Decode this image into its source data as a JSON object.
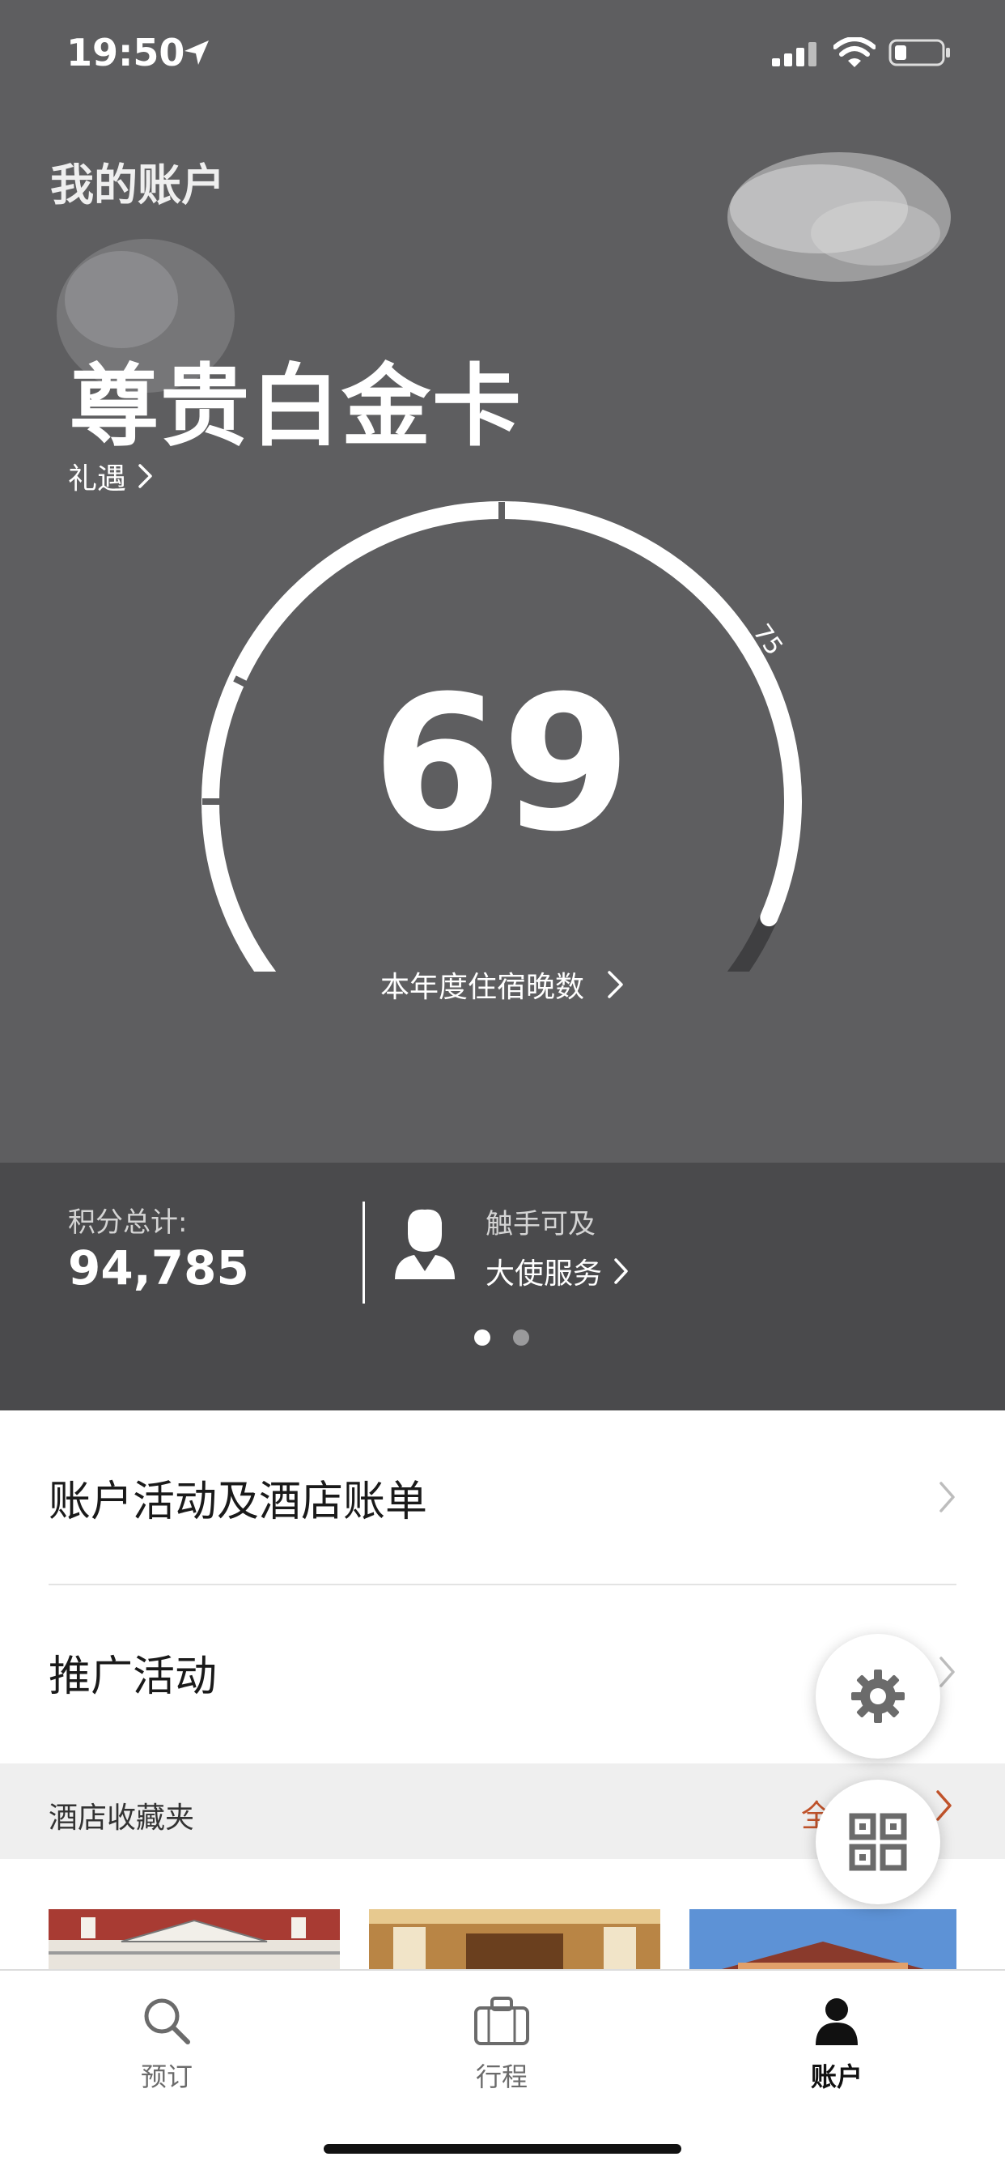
{
  "status_bar": {
    "time": "19:50"
  },
  "header": {
    "title": "我的账户",
    "tier": "尊贵白金卡",
    "benefits_link": "礼遇"
  },
  "nights": {
    "value": "69",
    "label": "本年度住宿晚数",
    "gauge_progress": 0.92,
    "threshold_label": "75"
  },
  "summary": {
    "points_label": "积分总计:",
    "points_value": "94,785",
    "ambassador_sub": "触手可及",
    "ambassador_main": "大使服务"
  },
  "list": {
    "activity": "账户活动及酒店账单",
    "promotions": "推广活动"
  },
  "favorites": {
    "label": "酒店收藏夹",
    "view_all": "全"
  },
  "tabbar": {
    "tabs": [
      {
        "label": "预订"
      },
      {
        "label": "行程"
      },
      {
        "label": "账户"
      }
    ]
  },
  "colors": {
    "header_bg": "#5e5e60",
    "bar_bg": "#4a4a4c",
    "accent": "#c0532b"
  }
}
